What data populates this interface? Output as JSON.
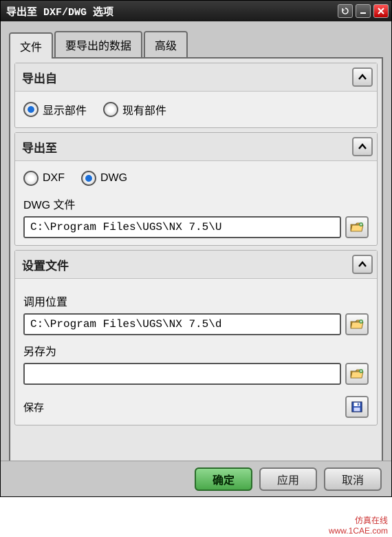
{
  "window": {
    "title": "导出至 DXF/DWG 选项"
  },
  "tabs": {
    "file": "文件",
    "data": "要导出的数据",
    "advanced": "高级"
  },
  "export_from": {
    "title": "导出自",
    "display_part": "显示部件",
    "existing_part": "现有部件"
  },
  "export_to": {
    "title": "导出至",
    "dxf": "DXF",
    "dwg": "DWG",
    "file_label": "DWG 文件",
    "file_path": "C:\\Program Files\\UGS\\NX 7.5\\U"
  },
  "settings_file": {
    "title": "设置文件",
    "recall_label": "调用位置",
    "recall_path": "C:\\Program Files\\UGS\\NX 7.5\\d",
    "saveas_label": "另存为",
    "saveas_path": "",
    "save_label": "保存"
  },
  "footer": {
    "ok": "确定",
    "apply": "应用",
    "cancel": "取消"
  },
  "watermark": {
    "line1": "仿真在线",
    "line2": "www.1CAE.com"
  }
}
